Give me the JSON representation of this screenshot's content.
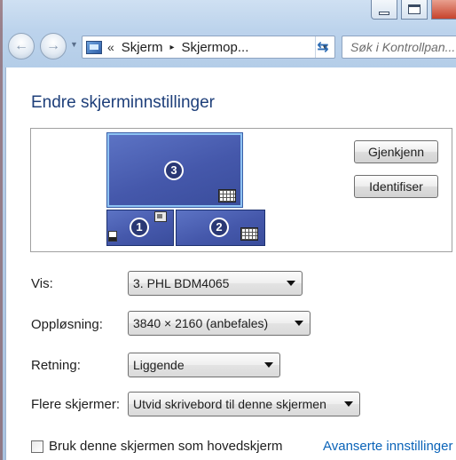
{
  "window": {
    "buttons": [
      "minimize",
      "maximize",
      "close"
    ]
  },
  "nav": {
    "back_icon": "back-arrow-icon",
    "forward_icon": "forward-arrow-icon"
  },
  "address": {
    "chevron": "«",
    "segments": [
      "Skjerm",
      "Skjermop..."
    ],
    "separator": "▸"
  },
  "search": {
    "placeholder": "Søk i Kontrollpan..."
  },
  "main": {
    "title": "Endre skjerminnstillinger",
    "monitors": [
      {
        "number": "3",
        "selected": true
      },
      {
        "number": "1",
        "selected": false
      },
      {
        "number": "2",
        "selected": false
      }
    ],
    "detect_label": "Gjenkjenn",
    "identify_label": "Identifiser"
  },
  "settings": {
    "display_label": "Vis:",
    "display_value": "3. PHL BDM4065",
    "resolution_label": "Oppløsning:",
    "resolution_value": "3840 × 2160 (anbefales)",
    "orientation_label": "Retning:",
    "orientation_value": "Liggende",
    "multiple_label": "Flere skjermer:",
    "multiple_value": "Utvid skrivebord til denne skjermen"
  },
  "footer": {
    "primary_checkbox_label": "Bruk denne skjermen som hovedskjerm",
    "primary_checked": false,
    "advanced_link": "Avanserte innstillinger"
  },
  "colors": {
    "title": "#1e3f7a",
    "link": "#0a63b8",
    "monitor": "#4558ab"
  }
}
